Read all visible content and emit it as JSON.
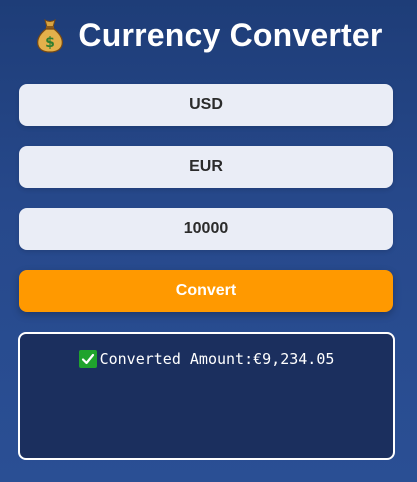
{
  "app": {
    "title": "Currency Converter",
    "title_icon": "money-bag-icon"
  },
  "form": {
    "from_currency": "USD",
    "to_currency": "EUR",
    "amount": "10000",
    "convert_label": "Convert"
  },
  "result": {
    "icon": "check-mark-icon",
    "label": "Converted Amount:",
    "value": "€9,234.05"
  },
  "colors": {
    "background": "#27498c",
    "button": "#ff9900",
    "field": "#eaedf6",
    "result_box": "#1b2f5e",
    "check": "#1fa32d"
  }
}
